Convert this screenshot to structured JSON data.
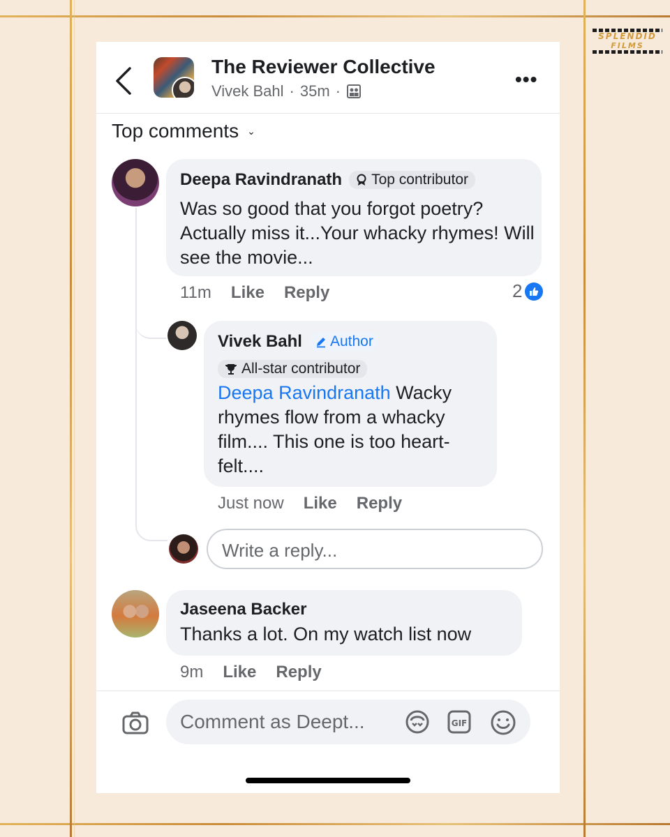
{
  "brand": {
    "line1": "SPLENDID",
    "line2": "FILMS"
  },
  "header": {
    "title": "The Reviewer Collective",
    "author": "Vivek Bahl",
    "time": "35m",
    "sep": "·"
  },
  "sort": {
    "label": "Top comments"
  },
  "comments": [
    {
      "name": "Deepa Ravindranath",
      "badge": "Top contributor",
      "text": "Was so good that you forgot poetry? Actually miss it...Your whacky rhymes! Will see the movie...",
      "time": "11m",
      "like": "Like",
      "reply": "Reply",
      "reactions": "2"
    },
    {
      "name": "Vivek Bahl",
      "author_badge": "Author",
      "badge": "All-star contributor",
      "mention": "Deepa Ravindranath",
      "text": " Wacky rhymes flow from a whacky film.... This one is too heart-felt....",
      "time": "Just now",
      "like": "Like",
      "reply": "Reply"
    },
    {
      "name": "Jaseena Backer",
      "text": "Thanks a lot. On my watch list now",
      "time": "9m",
      "like": "Like",
      "reply": "Reply"
    }
  ],
  "reply_box": {
    "placeholder": "Write a reply..."
  },
  "composer": {
    "placeholder": "Comment as Deept..."
  },
  "icons": {
    "back": "chevron-left-icon",
    "more": "more-horizontal-icon",
    "camera": "camera-icon",
    "avatar_sticker": "avatar-sticker-icon",
    "gif": "gif-icon",
    "emoji": "emoji-icon"
  },
  "colors": {
    "accent": "#1877f2",
    "bubble": "#f0f2f5",
    "background": "#f8eadb",
    "gold": "#d39a3b"
  }
}
